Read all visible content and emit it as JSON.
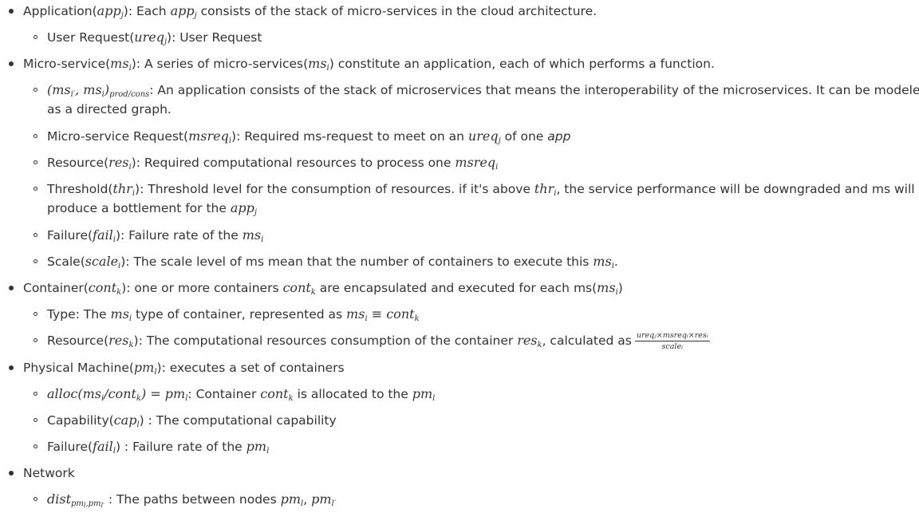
{
  "items": [
    {
      "label": "Application(",
      "math": "app",
      "sub": "j",
      "text": "): Each ",
      "math2": "app",
      "sub2": "j",
      "text2": " consists of the stack of micro-services in the cloud architecture.",
      "children": [
        {
          "label": "User Request(",
          "math": "ureq",
          "sub": "j",
          "text": "): User Request"
        }
      ]
    },
    {
      "label": "Micro-service(",
      "math": "ms",
      "sub": "i",
      "text": "): A series of micro-services(",
      "math2": "ms",
      "sub2": "i",
      "text2": ") constitute an application, each of which performs a function.",
      "children": [
        {
          "math": "(ms",
          "sub": "i′",
          "math_mid": ", ms",
          "sub_mid": "i",
          "math_end": ")",
          "sub_end": "prod/cons",
          "text": ": An application consists of the stack of microservices that means the interoperability of the microservices. It can be modeled",
          "text_cont": "as a directed graph."
        },
        {
          "label": "Micro-service Request(",
          "math": "msreq",
          "sub": "i",
          "text": "): Required ms-request to meet on an ",
          "math2": "ureq",
          "sub2": "j",
          "text2": " of one ",
          "text3": "app"
        },
        {
          "label": "Resource(",
          "math": "res",
          "sub": "i",
          "text": "): Required computational resources to process one ",
          "math2": "msreq",
          "sub2": "i"
        },
        {
          "label": "Threshold(",
          "math": "thr",
          "sub": "i",
          "text": "): Threshold level for the consumption of resources. if it's above ",
          "math2": "thr",
          "sub2": "i",
          "text2": ", the service performance will be downgraded and ms will",
          "text_cont": "produce a bottlement for the ",
          "math3": "app",
          "sub3": "j"
        },
        {
          "label": "Failure(",
          "math": "fail",
          "sub": "i",
          "text": "): Failure rate of the ",
          "math2": "ms",
          "sub2": "i"
        },
        {
          "label": "Scale(",
          "math": "scale",
          "sub": "i",
          "text": "): The scale level of ms mean that the number of containers to execute this ",
          "math2": "ms",
          "sub2": "i",
          "text2": "."
        }
      ]
    },
    {
      "label": "Container(",
      "math": "cont",
      "sub": "k",
      "text": "): one or more containers ",
      "math2": "cont",
      "sub2": "k",
      "text2": " are encapsulated and executed for each ms(",
      "math3": "ms",
      "sub3": "i",
      "text3": ")",
      "children": [
        {
          "label": "Type: The ",
          "math": "ms",
          "sub": "i",
          "text": " type of container, represented as ",
          "math2": "ms",
          "sub2": "i",
          "math2b": " ≡ cont",
          "sub2b": "k"
        },
        {
          "label": "Resource(",
          "math": "res",
          "sub": "k",
          "text": "): The computational resources consumption of the container ",
          "math2": "res",
          "sub2": "k",
          "text2": ", calculated as",
          "frac_num": "ureqⱼ×msreqᵢ×resᵢ",
          "frac_den": "scaleᵢ"
        }
      ]
    },
    {
      "label": "Physical Machine(",
      "math": "pm",
      "sub": "l",
      "text": "): executes a set of containers",
      "children": [
        {
          "math": "alloc(ms",
          "sub": "i",
          "math_mid": "/cont",
          "sub_mid": "k",
          "math_end": ") = pm",
          "sub_end": "l",
          "text": ": Container ",
          "math2": "cont",
          "sub2": "k",
          "text2": " is allocated to the ",
          "math3": "pm",
          "sub3": "l"
        },
        {
          "label": "Capability(",
          "math": "cap",
          "sub": "l",
          "text": ") : The computational capability"
        },
        {
          "label": "Failure(",
          "math": "fail",
          "sub": "l",
          "text": ") : Failure rate of the ",
          "math2": "pm",
          "sub2": "l"
        }
      ]
    },
    {
      "label": "Network",
      "children": [
        {
          "math": "dist",
          "sub_a": "pm",
          "sub_a1": "l",
          "sub_b": ",pm",
          "sub_b1": "l′",
          "text": " : The paths between nodes ",
          "math2": "pm",
          "sub2": "l",
          "text2": ", ",
          "math3": "pm",
          "sub3": "l′"
        }
      ]
    }
  ]
}
